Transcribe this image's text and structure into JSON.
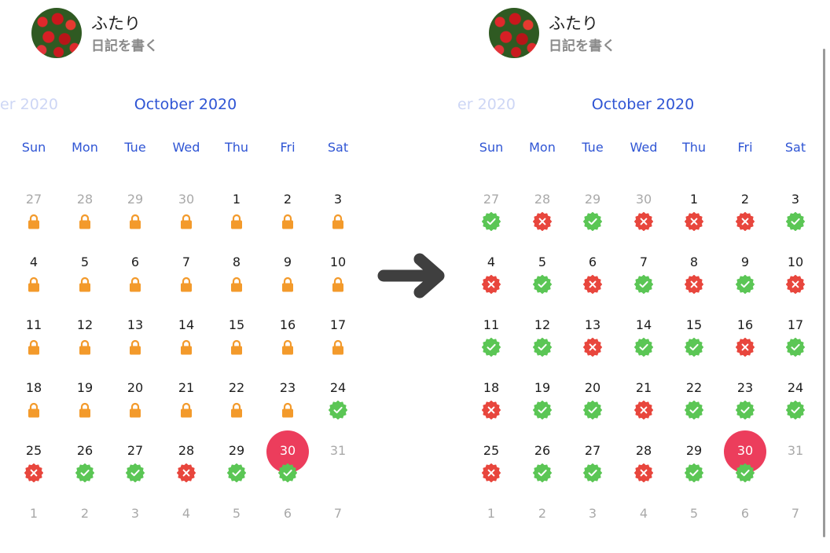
{
  "header": {
    "app_name": "ふたり",
    "write_diary": "日記を書く"
  },
  "calendar": {
    "prev_month_partial": "ber 2020",
    "current_month": "October 2020",
    "weekdays": [
      "Sun",
      "Mon",
      "Tue",
      "Wed",
      "Thu",
      "Fri",
      "Sat"
    ],
    "today": "30",
    "weeks": [
      [
        "27",
        "28",
        "29",
        "30",
        "1",
        "2",
        "3"
      ],
      [
        "4",
        "5",
        "6",
        "7",
        "8",
        "9",
        "10"
      ],
      [
        "11",
        "12",
        "13",
        "14",
        "15",
        "16",
        "17"
      ],
      [
        "18",
        "19",
        "20",
        "21",
        "22",
        "23",
        "24"
      ],
      [
        "25",
        "26",
        "27",
        "28",
        "29",
        "30",
        "31"
      ],
      [
        "1",
        "2",
        "3",
        "4",
        "5",
        "6",
        "7"
      ]
    ],
    "other_month": [
      [
        true,
        true,
        true,
        true,
        false,
        false,
        false
      ],
      [
        false,
        false,
        false,
        false,
        false,
        false,
        false
      ],
      [
        false,
        false,
        false,
        false,
        false,
        false,
        false
      ],
      [
        false,
        false,
        false,
        false,
        false,
        false,
        false
      ],
      [
        false,
        false,
        false,
        false,
        false,
        false,
        true
      ],
      [
        true,
        true,
        true,
        true,
        true,
        true,
        true
      ]
    ],
    "before_marks": [
      [
        "lock",
        "lock",
        "lock",
        "lock",
        "lock",
        "lock",
        "lock"
      ],
      [
        "lock",
        "lock",
        "lock",
        "lock",
        "lock",
        "lock",
        "lock"
      ],
      [
        "lock",
        "lock",
        "lock",
        "lock",
        "lock",
        "lock",
        "lock"
      ],
      [
        "lock",
        "lock",
        "lock",
        "lock",
        "lock",
        "lock",
        "check"
      ],
      [
        "cross",
        "check",
        "check",
        "cross",
        "check",
        "check",
        ""
      ],
      [
        "",
        "",
        "",
        "",
        "",
        "",
        ""
      ]
    ],
    "after_marks": [
      [
        "check",
        "cross",
        "check",
        "cross",
        "cross",
        "cross",
        "check"
      ],
      [
        "cross",
        "check",
        "cross",
        "check",
        "cross",
        "check",
        "cross"
      ],
      [
        "check",
        "check",
        "cross",
        "check",
        "check",
        "cross",
        "check"
      ],
      [
        "cross",
        "check",
        "check",
        "cross",
        "check",
        "check",
        "check"
      ],
      [
        "cross",
        "check",
        "check",
        "cross",
        "check",
        "check",
        ""
      ],
      [
        "",
        "",
        "",
        "",
        "",
        "",
        ""
      ]
    ]
  },
  "icons": {
    "lock": "lock-icon",
    "check": "check-badge-icon",
    "cross": "cross-badge-icon",
    "arrow": "arrow-right-icon"
  },
  "colors": {
    "accent": "#2f55d4",
    "lock": "#f39a2b",
    "check": "#5bc655",
    "cross": "#e8463d",
    "today": "#ec3d5c"
  }
}
